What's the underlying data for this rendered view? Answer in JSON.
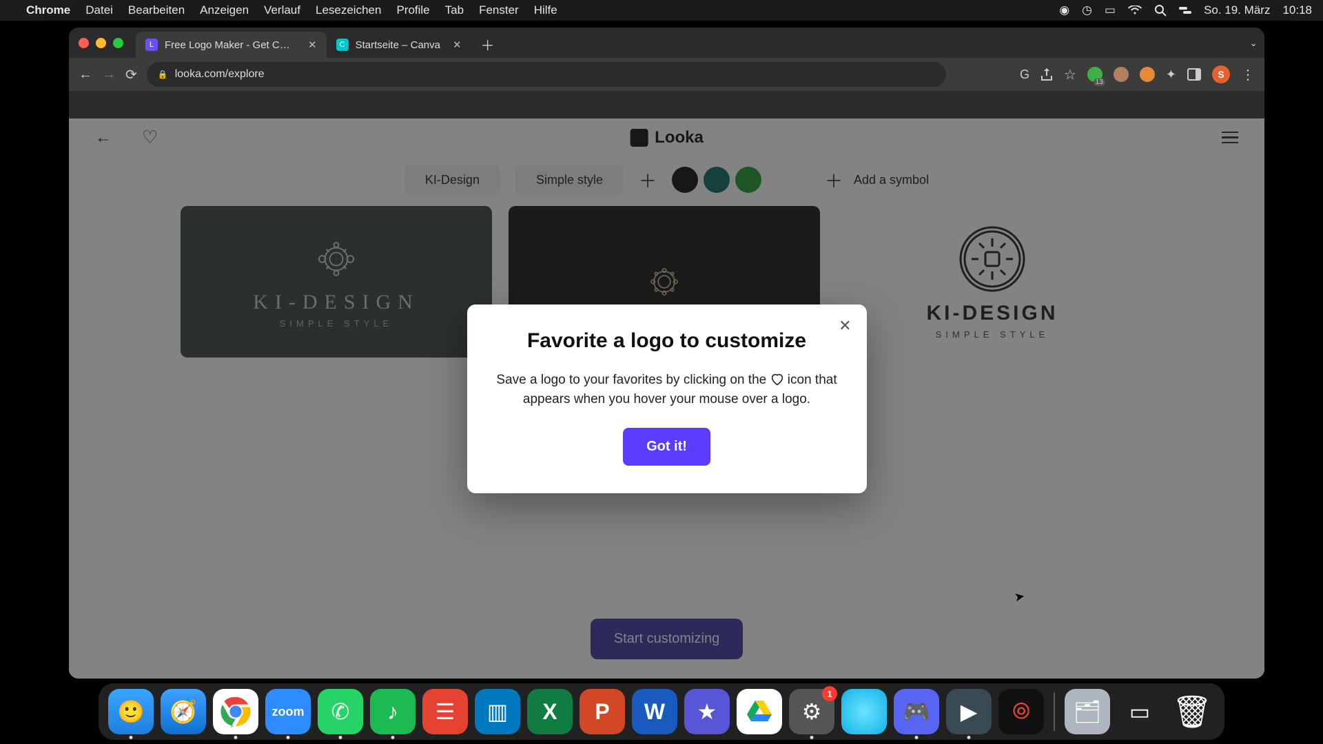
{
  "menubar": {
    "app": "Chrome",
    "items": [
      "Datei",
      "Bearbeiten",
      "Anzeigen",
      "Verlauf",
      "Lesezeichen",
      "Profile",
      "Tab",
      "Fenster",
      "Hilfe"
    ],
    "date": "So. 19. März",
    "time": "10:18"
  },
  "tabs": {
    "active": "Free Logo Maker - Get Custom",
    "inactive": "Startseite – Canva"
  },
  "address": {
    "url": "looka.com/explore"
  },
  "extension_badge": "13",
  "profile_initial": "S",
  "app": {
    "brand": "Looka",
    "chip1": "KI-Design",
    "chip2": "Simple style",
    "add_symbol": "Add a symbol",
    "colors": [
      "#111111",
      "#0f6b63",
      "#1f9e2f"
    ],
    "cta": "Start customizing"
  },
  "logos": {
    "title": "KI-DESIGN",
    "sub": "SIMPLE STYLE"
  },
  "modal": {
    "title": "Favorite a logo to customize",
    "body_a": "Save a logo to your favorites by clicking on the ",
    "body_b": " icon that appears when you hover your mouse over a logo.",
    "button": "Got it!"
  },
  "dock_badge": "1"
}
